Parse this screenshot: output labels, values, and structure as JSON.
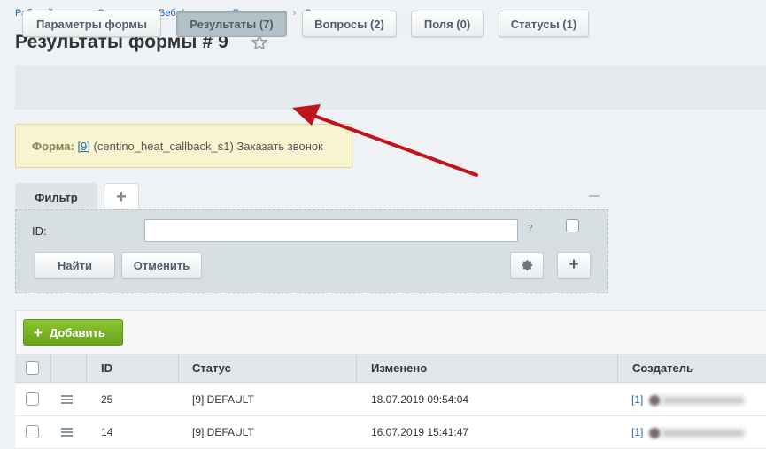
{
  "breadcrumb": {
    "items": [
      "Рабочий стол",
      "Сервисы",
      "Веб-формы",
      "Результаты",
      "Заказать звонок"
    ],
    "separator": "›"
  },
  "page": {
    "title": "Результаты формы # 9"
  },
  "tabs": [
    {
      "label": "Параметры формы",
      "active": false
    },
    {
      "label": "Результаты (7)",
      "active": true
    },
    {
      "label": "Вопросы (2)",
      "active": false
    },
    {
      "label": "Поля (0)",
      "active": false
    },
    {
      "label": "Статусы (1)",
      "active": false
    }
  ],
  "info": {
    "label": "Форма:",
    "form_link": "[9]",
    "text": "(centino_heat_callback_s1) Заказать звонок"
  },
  "filter": {
    "tab_label": "Фильтр",
    "add_tab_label": "+",
    "field_label": "ID:",
    "field_value": "",
    "help": "?",
    "find_label": "Найти",
    "cancel_label": "Отменить",
    "settings_icon": "gear-icon",
    "add_field_label": "+"
  },
  "grid": {
    "add_button_label": "Добавить",
    "add_button_icon": "+",
    "columns": [
      "ID",
      "Статус",
      "Изменено",
      "Создатель"
    ],
    "rows": [
      {
        "id": "25",
        "status": "[9] DEFAULT",
        "modified": "18.07.2019 09:54:04",
        "creator_id": "[1]"
      },
      {
        "id": "14",
        "status": "[9] DEFAULT",
        "modified": "16.07.2019 15:41:47",
        "creator_id": "[1]"
      }
    ]
  },
  "colors": {
    "accent_link": "#2067b0",
    "annotation_arrow": "#c0141c",
    "add_button": "#7ab325",
    "info_background": "#f8f4cf"
  }
}
